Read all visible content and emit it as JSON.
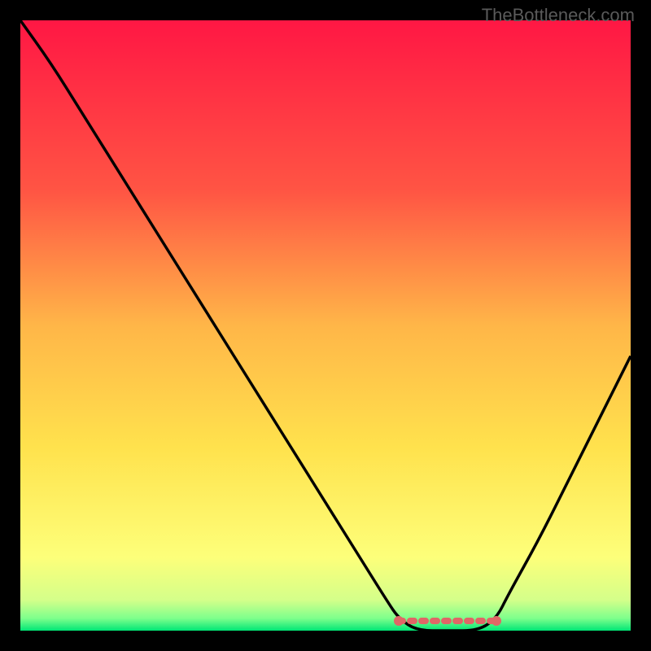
{
  "watermark": "TheBottleneck.com",
  "chart_data": {
    "type": "line",
    "title": "",
    "xlabel": "",
    "ylabel": "",
    "xlim": [
      0,
      100
    ],
    "ylim": [
      0,
      100
    ],
    "series": [
      {
        "name": "bottleneck-curve",
        "x": [
          0,
          5,
          10,
          15,
          20,
          25,
          30,
          35,
          40,
          45,
          50,
          55,
          60,
          62,
          65,
          70,
          75,
          78,
          80,
          85,
          90,
          95,
          100
        ],
        "y": [
          100,
          93,
          85,
          77,
          69,
          61,
          53,
          45,
          37,
          29,
          21,
          13,
          5,
          2,
          0,
          0,
          0,
          2,
          6,
          15,
          25,
          35,
          45
        ]
      }
    ],
    "optimal_zone": {
      "x_start": 62,
      "x_end": 78
    },
    "gradient_stops": [
      {
        "offset": 0,
        "color": "#ff1744"
      },
      {
        "offset": 28,
        "color": "#ff5544"
      },
      {
        "offset": 50,
        "color": "#ffb648"
      },
      {
        "offset": 70,
        "color": "#ffe24d"
      },
      {
        "offset": 88,
        "color": "#fdff7a"
      },
      {
        "offset": 95,
        "color": "#d4ff8a"
      },
      {
        "offset": 98,
        "color": "#7dff8c"
      },
      {
        "offset": 100,
        "color": "#00e676"
      }
    ]
  }
}
